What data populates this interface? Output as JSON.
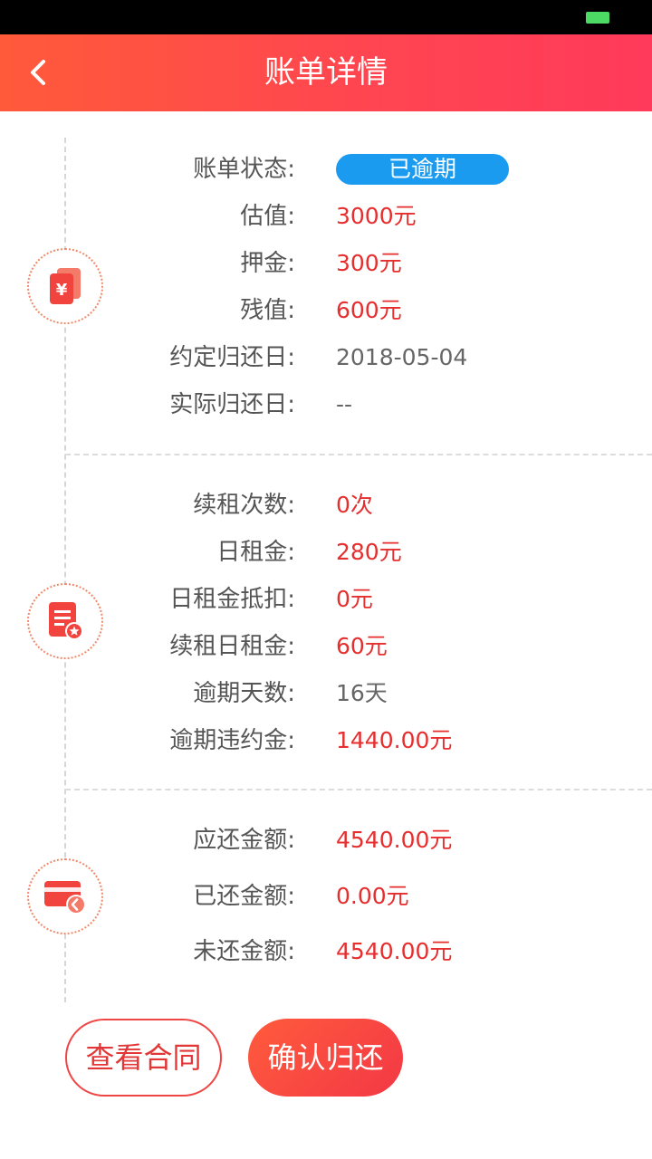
{
  "nav": {
    "title": "账单详情",
    "back_icon": "chevron-left-icon"
  },
  "colors": {
    "accent": "#ff4452",
    "value_red": "#e62e2e",
    "status_blue": "#1a9bf0"
  },
  "section1": {
    "icon": "yuan-cards-icon",
    "rows": [
      {
        "label": "账单状态:",
        "value": "已逾期"
      },
      {
        "label": "估值:",
        "value": "3000元"
      },
      {
        "label": "押金:",
        "value": "300元"
      },
      {
        "label": "残值:",
        "value": "600元"
      },
      {
        "label": "约定归还日:",
        "value": "2018-05-04"
      },
      {
        "label": "实际归还日:",
        "value": "--"
      }
    ]
  },
  "section2": {
    "icon": "document-badge-icon",
    "rows": [
      {
        "label": "续租次数:",
        "value": "0次"
      },
      {
        "label": "日租金:",
        "value": "280元"
      },
      {
        "label": "日租金抵扣:",
        "value": "0元"
      },
      {
        "label": "续租日租金:",
        "value": "60元"
      },
      {
        "label": "逾期天数:",
        "value": "16天"
      },
      {
        "label": "逾期违约金:",
        "value": "1440.00元"
      }
    ]
  },
  "section3": {
    "icon": "card-return-icon",
    "rows": [
      {
        "label": "应还金额:",
        "value": "4540.00元"
      },
      {
        "label": "已还金额:",
        "value": "0.00元"
      },
      {
        "label": "未还金额:",
        "value": "4540.00元"
      }
    ]
  },
  "buttons": {
    "view_contract": "查看合同",
    "confirm_return": "确认归还"
  }
}
